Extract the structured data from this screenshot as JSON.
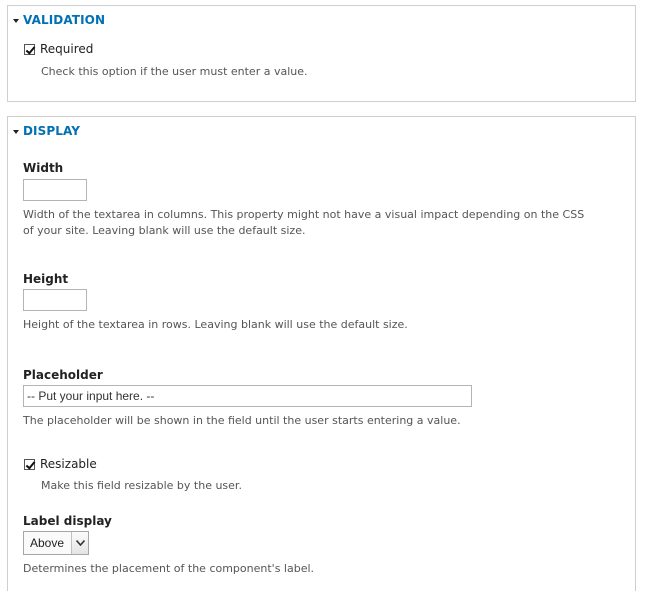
{
  "validation": {
    "legend": "VALIDATION",
    "required_label": "Required",
    "required_checked": true,
    "required_desc": "Check this option if the user must enter a value."
  },
  "display": {
    "legend": "DISPLAY",
    "width": {
      "label": "Width",
      "value": "",
      "desc_line1": "Width of the textarea in columns. This property might not have a visual impact depending on the CSS",
      "desc_line2": "of your site. Leaving blank will use the default size."
    },
    "height": {
      "label": "Height",
      "value": "",
      "desc": "Height of the textarea in rows. Leaving blank will use the default size."
    },
    "placeholder": {
      "label": "Placeholder",
      "value": "-- Put your input here. --",
      "desc": "The placeholder will be shown in the field until the user starts entering a value."
    },
    "resizable": {
      "label": "Resizable",
      "checked": true,
      "desc": "Make this field resizable by the user."
    },
    "label_display": {
      "label": "Label display",
      "selected": "Above",
      "desc": "Determines the placement of the component's label."
    }
  },
  "icons": {
    "legend_toggle": "triangle-down-icon",
    "select_arrow": "chevron-down-icon"
  },
  "colors": {
    "legend": "#0071b3",
    "border": "#cfcfcf"
  }
}
